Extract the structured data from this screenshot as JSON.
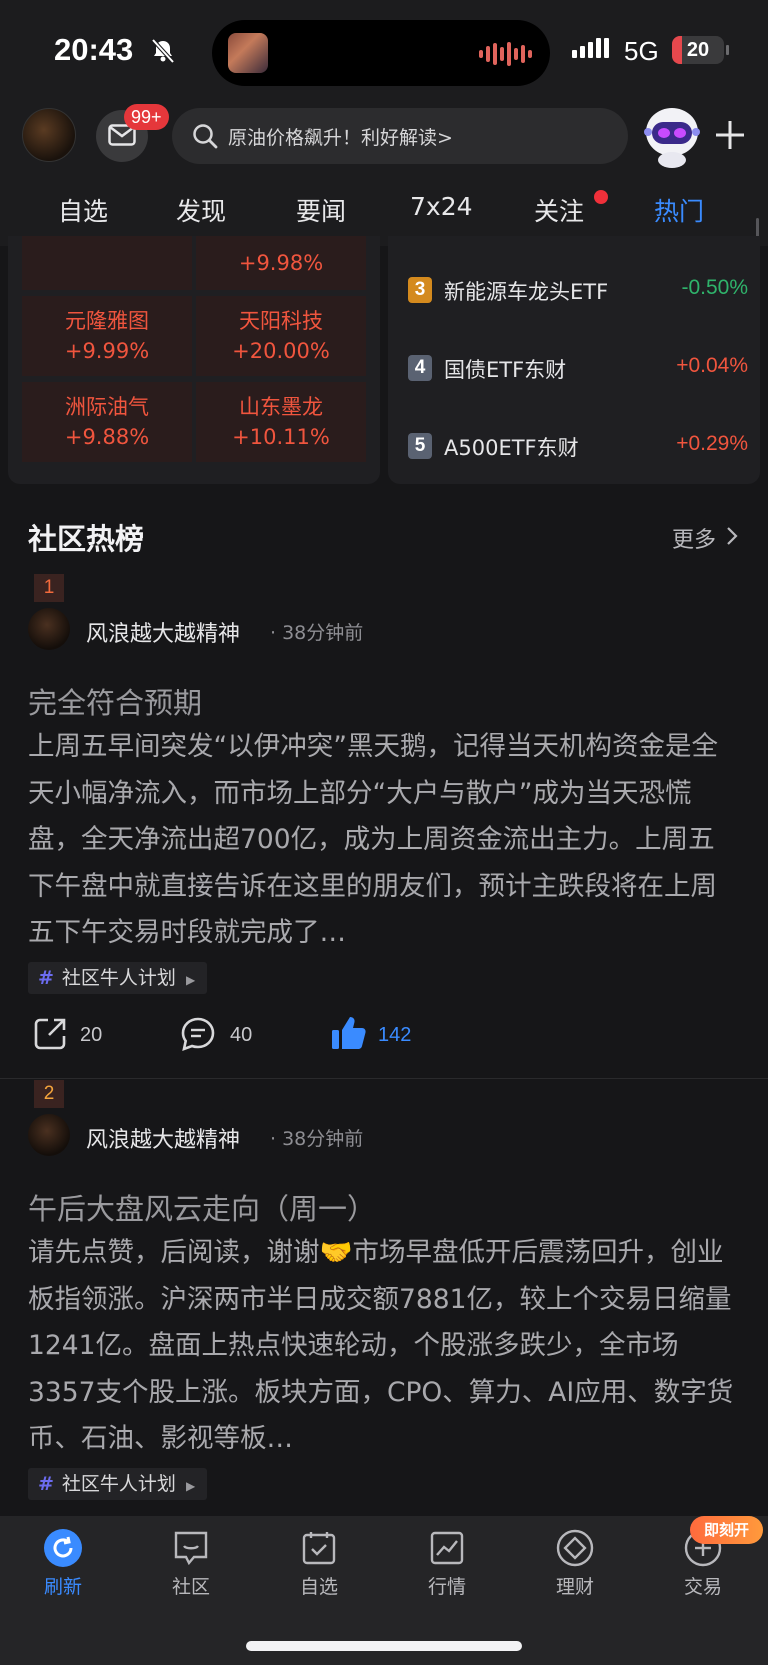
{
  "status_bar": {
    "time": "20:43",
    "network": "5G",
    "battery": "20",
    "battery_level": 0.2
  },
  "header": {
    "mail_badge": "99+",
    "search_text": "原油价格飙升！利好解读>"
  },
  "tabs": [
    {
      "label": "自选",
      "active": false
    },
    {
      "label": "发现",
      "active": false
    },
    {
      "label": "要闻",
      "active": false
    },
    {
      "label": "7x24",
      "active": false
    },
    {
      "label": "关注",
      "active": false,
      "dot": true
    },
    {
      "label": "热门",
      "active": true
    }
  ],
  "stock_grid": [
    {
      "name": "",
      "change": ""
    },
    {
      "name": "",
      "change": "+9.98%"
    },
    {
      "name": "元隆雅图",
      "change": "+9.99%"
    },
    {
      "name": "天阳科技",
      "change": "+20.00%"
    },
    {
      "name": "洲际油气",
      "change": "+9.88%"
    },
    {
      "name": "山东墨龙",
      "change": "+10.11%"
    }
  ],
  "etf_list": [
    {
      "rank": "3",
      "name": "新能源车龙头ETF",
      "change": "-0.50%",
      "direction": "down"
    },
    {
      "rank": "4",
      "name": "国债ETF东财",
      "change": "+0.04%",
      "direction": "up"
    },
    {
      "rank": "5",
      "name": "A500ETF东财",
      "change": "+0.29%",
      "direction": "up"
    }
  ],
  "community": {
    "title": "社区热榜",
    "more": "更多",
    "posts": [
      {
        "rank": "1",
        "author": "风浪越大越精神",
        "time": "38分钟前",
        "title": "完全符合预期",
        "body": "上周五早间突发“以伊冲突”黑天鹅，记得当天机构资金是全天小幅净流入，而市场上部分“大户与散户”成为当天恐慌盘，全天净流出超700亿，成为上周资金流出主力。上周五下午盘中就直接告诉在这里的朋友们，预计主跌段将在上周五下午交易时段就完成了…",
        "tag": "社区牛人计划",
        "shares": "20",
        "comments": "40",
        "likes": "142"
      },
      {
        "rank": "2",
        "author": "风浪越大越精神",
        "time": "38分钟前",
        "title": "午后大盘风云走向（周一）",
        "body": "请先点赞，后阅读，谢谢🤝市场早盘低开后震荡回升，创业板指领涨。沪深两市半日成交额7881亿，较上个交易日缩量1241亿。盘面上热点快速轮动，个股涨多跌少，全市场3357支个股上涨。板块方面，CPO、算力、AI应用、数字货币、石油、影视等板…",
        "tag": "社区牛人计划"
      }
    ]
  },
  "bottom_nav": [
    {
      "label": "刷新",
      "icon": "refresh-icon",
      "active": true
    },
    {
      "label": "社区",
      "icon": "community-icon",
      "active": false
    },
    {
      "label": "自选",
      "icon": "watchlist-icon",
      "active": false
    },
    {
      "label": "行情",
      "icon": "market-chart-icon",
      "active": false
    },
    {
      "label": "理财",
      "icon": "wealth-icon",
      "active": false
    },
    {
      "label": "交易",
      "icon": "trade-icon",
      "active": false
    }
  ],
  "promo_badge": "即刻开",
  "colors": {
    "accent": "#3a8bff",
    "up": "#f0553e",
    "down": "#2fb36b",
    "background": "#161618"
  }
}
